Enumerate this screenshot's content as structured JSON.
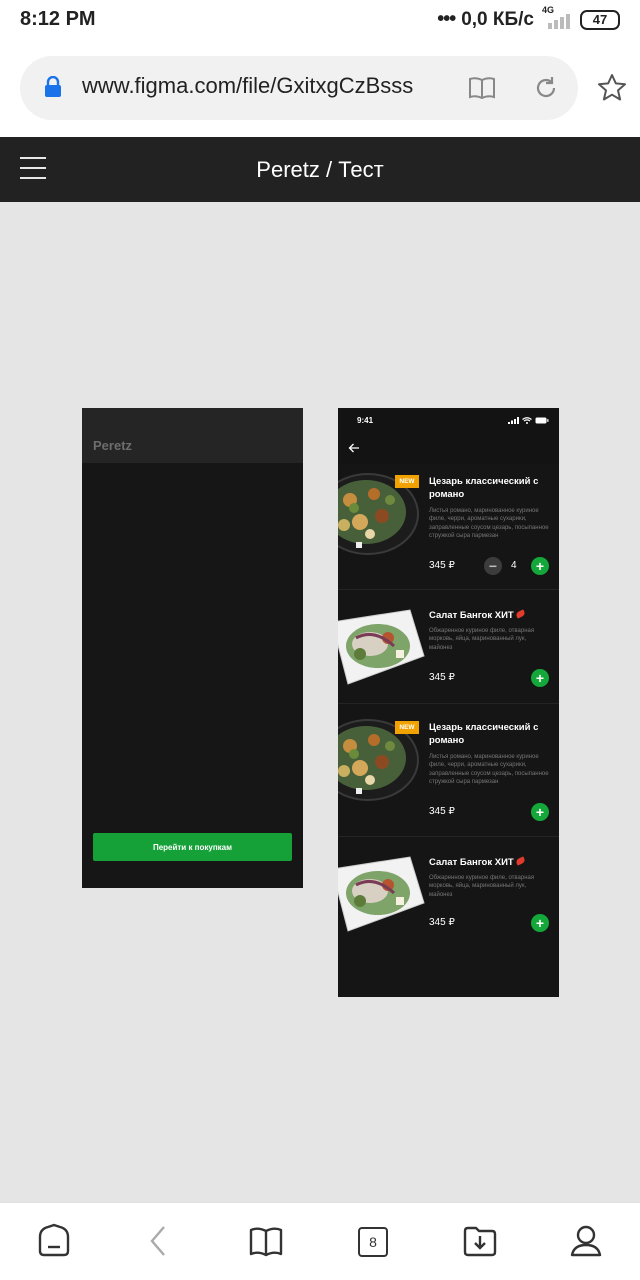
{
  "status_bar": {
    "time": "8:12 PM",
    "dots": "•••",
    "speed": "0,0 КБ/с",
    "network": "4G",
    "battery": "47"
  },
  "browser": {
    "url": "www.figma.com/file/GxitxgCzBsss"
  },
  "figma_header": {
    "title": "Peretz / Тест"
  },
  "frame_splash": {
    "brand": "Peretz",
    "button_label": "Перейти к покупкам"
  },
  "frame_menu": {
    "time": "9:41",
    "items": [
      {
        "badge": "NEW",
        "title": "Цезарь классический с романо",
        "description": "Листья романо, маринованное куриное филе, черри, ароматные сухарики, заправленные соусом цезарь, посыпанное стружкой сыра пармезан",
        "price": "345 ₽",
        "quantity": "4"
      },
      {
        "title": "Салат Бангок ХИТ",
        "description": "Обжаренное куриное филе, отварная морковь, яйца, маринованный лук, майонез",
        "price": "345 ₽"
      },
      {
        "badge": "NEW",
        "title": "Цезарь классический с романо",
        "description": "Листья романо, маринованное куриное филе, черри, ароматные сухарики, заправленные соусом цезарь, посыпанное стружкой сыра пармезан",
        "price": "345 ₽"
      },
      {
        "title": "Салат Бангок ХИТ",
        "description": "Обжаренное куриное филе, отварная морковь, яйца, маринованный лук, майонез",
        "price": "345 ₽"
      }
    ]
  },
  "bottom_nav": {
    "tab_count": "8"
  },
  "colors": {
    "accent_green": "#15a137",
    "badge_orange": "#f2a200",
    "canvas_bg": "#e5e5e5",
    "header_bg": "#222222"
  }
}
